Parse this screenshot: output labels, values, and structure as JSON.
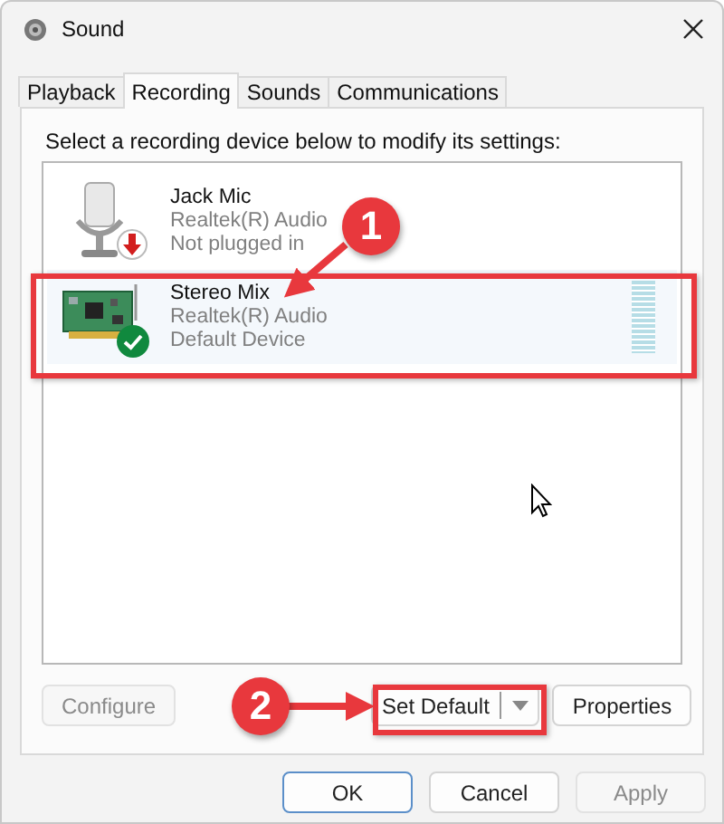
{
  "window": {
    "title": "Sound"
  },
  "tabs": [
    {
      "label": "Playback",
      "selected": false
    },
    {
      "label": "Recording",
      "selected": true
    },
    {
      "label": "Sounds",
      "selected": false
    },
    {
      "label": "Communications",
      "selected": false
    }
  ],
  "instruction": "Select a recording device below to modify its settings:",
  "devices": [
    {
      "kind": "mic",
      "name": "Jack Mic",
      "driver": "Realtek(R) Audio",
      "status": "Not plugged in",
      "plugged_in": false,
      "is_default": false,
      "selected": false
    },
    {
      "kind": "card",
      "name": "Stereo Mix",
      "driver": "Realtek(R) Audio",
      "status": "Default Device",
      "plugged_in": true,
      "is_default": true,
      "selected": true
    }
  ],
  "device_buttons": [
    {
      "label": "Configure",
      "disabled": true,
      "dropdown": false
    },
    {
      "label": "Set Default",
      "disabled": false,
      "dropdown": true
    },
    {
      "label": "Properties",
      "disabled": false,
      "dropdown": false
    }
  ],
  "dialog_buttons": [
    {
      "label": "OK",
      "default": true,
      "disabled": false
    },
    {
      "label": "Cancel",
      "default": false,
      "disabled": false
    },
    {
      "label": "Apply",
      "default": false,
      "disabled": true
    }
  ],
  "annotations": [
    {
      "number": "1"
    },
    {
      "number": "2"
    }
  ]
}
